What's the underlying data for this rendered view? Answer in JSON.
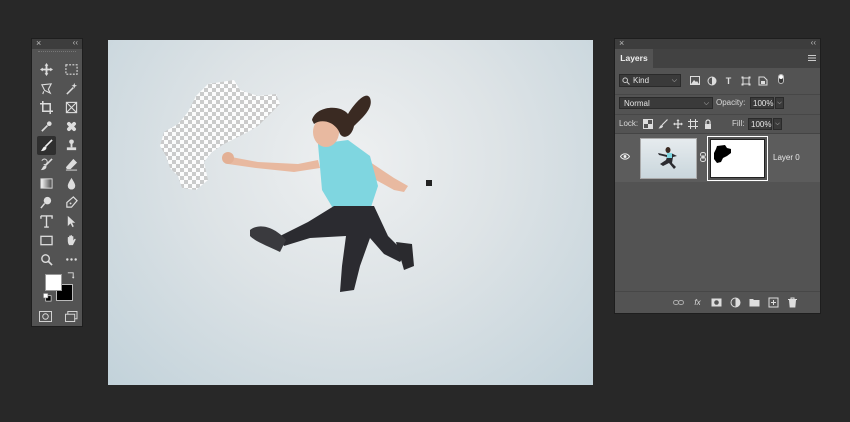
{
  "tools_panel": {
    "close_glyph": "×",
    "collapse_glyph": "‹‹",
    "tools": [
      {
        "name": "move-tool"
      },
      {
        "name": "marquee-tool"
      },
      {
        "name": "lasso-tool"
      },
      {
        "name": "magic-wand-tool"
      },
      {
        "name": "crop-tool"
      },
      {
        "name": "frame-tool"
      },
      {
        "name": "eyedropper-tool"
      },
      {
        "name": "healing-brush-tool"
      },
      {
        "name": "brush-tool",
        "active": true
      },
      {
        "name": "clone-stamp-tool"
      },
      {
        "name": "history-brush-tool"
      },
      {
        "name": "eraser-tool"
      },
      {
        "name": "gradient-tool"
      },
      {
        "name": "blur-tool"
      },
      {
        "name": "dodge-tool"
      },
      {
        "name": "pen-tool"
      },
      {
        "name": "type-tool"
      },
      {
        "name": "path-selection-tool"
      },
      {
        "name": "rectangle-tool"
      },
      {
        "name": "hand-tool"
      },
      {
        "name": "zoom-tool"
      },
      {
        "name": "more-tools"
      }
    ],
    "foreground_color": "#ffffff",
    "background_color": "#000000"
  },
  "layers_panel": {
    "close_glyph": "×",
    "collapse_glyph": "‹‹",
    "tab_label": "Layers",
    "filter": {
      "kind_label": "Kind",
      "icons": [
        "image-filter-icon",
        "adjustment-filter-icon",
        "type-filter-icon",
        "shape-filter-icon",
        "smart-object-filter-icon"
      ],
      "type_glyph": "T"
    },
    "blend_mode": "Normal",
    "opacity_label": "Opacity:",
    "opacity_value": "100%",
    "lock_label": "Lock:",
    "fill_label": "Fill:",
    "fill_value": "100%",
    "layers": [
      {
        "name": "Layer 0",
        "visible": true,
        "has_mask": true
      }
    ],
    "footer_fx": "fx"
  },
  "colors": {
    "app_bg": "#282828",
    "panel_bg": "#535353",
    "panel_header": "#3d3d3d",
    "field_bg": "#3a3a3a",
    "shirt": "#7fd6e0",
    "leggings": "#2b2b30"
  }
}
